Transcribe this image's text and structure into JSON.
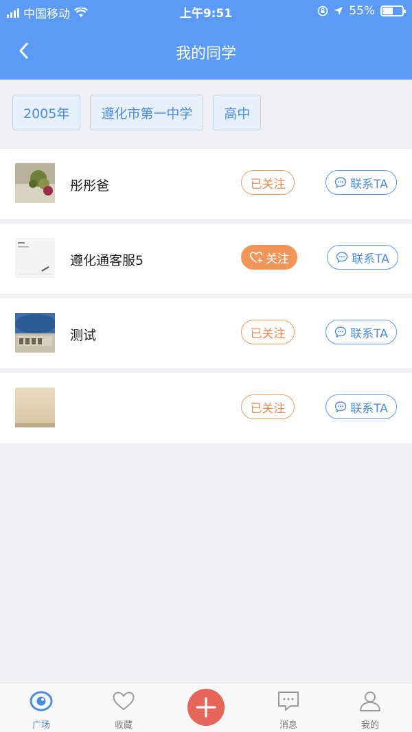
{
  "status_bar": {
    "carrier": "中国移动",
    "time": "上午9:51",
    "battery_percent": "55%",
    "battery_level": 0.55
  },
  "header": {
    "title": "我的同学",
    "background": "#5b9bf5"
  },
  "filters": [
    "2005年",
    "遵化市第一中学",
    "高中"
  ],
  "classmates": [
    {
      "name": "彤彤爸",
      "follow_label": "已关注",
      "followed": true,
      "contact_label": "联系TA"
    },
    {
      "name": "遵化通客服5",
      "follow_label": "关注",
      "followed": false,
      "contact_label": "联系TA"
    },
    {
      "name": "测试",
      "follow_label": "已关注",
      "followed": true,
      "contact_label": "联系TA"
    },
    {
      "name": "",
      "follow_label": "已关注",
      "followed": true,
      "contact_label": "联系TA"
    }
  ],
  "tabbar": {
    "items": [
      {
        "label": "广场",
        "icon": "eye-icon",
        "active": true
      },
      {
        "label": "收藏",
        "icon": "heart-icon",
        "active": false
      },
      {
        "label": "",
        "icon": "plus-icon",
        "active": false
      },
      {
        "label": "消息",
        "icon": "chat-icon",
        "active": false
      },
      {
        "label": "我的",
        "icon": "user-icon",
        "active": false
      }
    ]
  },
  "colors": {
    "accent": "#5b9bf5",
    "follow": "#f0874a",
    "plus": "#e7665b"
  }
}
